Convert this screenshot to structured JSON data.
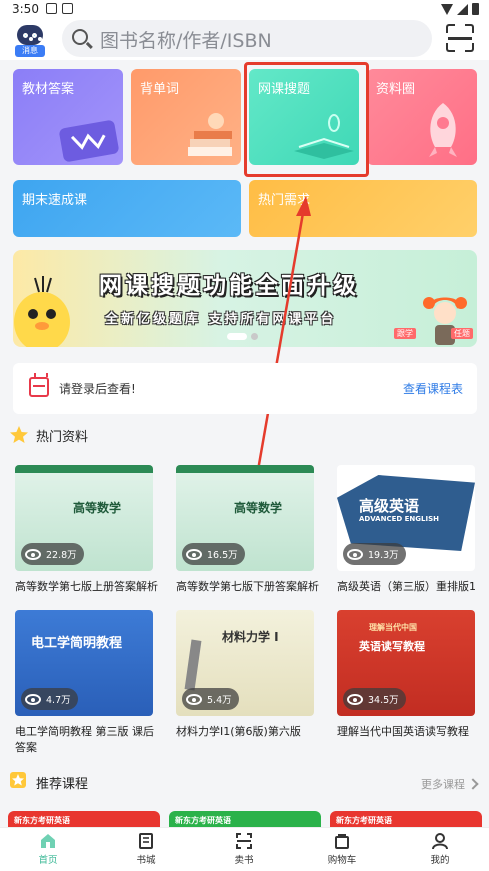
{
  "status_bar": {
    "time": "3:50"
  },
  "header": {
    "robot_badge": "消息",
    "search_placeholder": "图书名称/作者/ISBN"
  },
  "categories": [
    {
      "label": "教材答案",
      "color": "#8b7ef7"
    },
    {
      "label": "背单词",
      "color": "#ff9a6a"
    },
    {
      "label": "网课搜题",
      "color": "#4fe0bf"
    },
    {
      "label": "资料圈",
      "color": "#ff7a90"
    },
    {
      "label": "期末速成课",
      "color": "#3ea5f0"
    },
    {
      "label": "热门需求",
      "color": "#ffbd45"
    }
  ],
  "banner": {
    "headline": "网课搜题功能全面升级",
    "subline": "全新亿级题库   支持所有网课平台",
    "badge_left": "跟学",
    "badge_right": "任题"
  },
  "login_bar": {
    "text": "请登录后查看!",
    "link": "查看课程表"
  },
  "hot_section": {
    "title": "热门资料"
  },
  "books": [
    {
      "title": "高等数学第七版上册答案解析",
      "views": "22.8万",
      "cover_text": "高等数学"
    },
    {
      "title": "高等数学第七版下册答案解析",
      "views": "16.5万",
      "cover_text": "高等数学"
    },
    {
      "title": "高级英语（第三版）重排版1",
      "views": "19.3万",
      "cover_text": "高级英语",
      "cover_subtext": "ADVANCED ENGLISH"
    },
    {
      "title": "电工学简明教程 第三版 课后答案",
      "views": "4.7万",
      "cover_text": "电工学简明教程"
    },
    {
      "title": "材料力学I1(第6版)第六版",
      "views": "5.4万",
      "cover_text": "材料力学 I"
    },
    {
      "title": "理解当代中国英语读写教程",
      "views": "34.5万",
      "cover_text": "英语读写教程",
      "cover_subtext": "理解当代中国"
    }
  ],
  "recommend_section": {
    "title": "推荐课程",
    "more": "更多课程"
  },
  "course_strip": [
    "新东方考研英语",
    "新东方考研英语",
    "新东方考研英语"
  ],
  "tabs": [
    {
      "label": "首页",
      "icon": "home-icon",
      "active": true
    },
    {
      "label": "书城",
      "icon": "book-icon",
      "active": false
    },
    {
      "label": "卖书",
      "icon": "scan-icon",
      "active": false
    },
    {
      "label": "购物车",
      "icon": "bag-icon",
      "active": false
    },
    {
      "label": "我的",
      "icon": "user-icon",
      "active": false
    }
  ]
}
